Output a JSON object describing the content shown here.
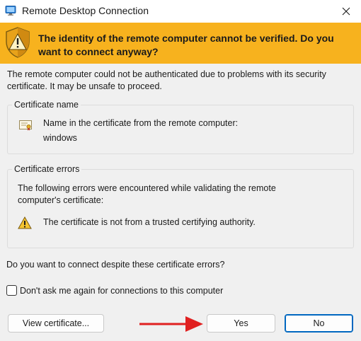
{
  "window": {
    "title": "Remote Desktop Connection",
    "close_glyph": "✕"
  },
  "banner": {
    "message": "The identity of the remote computer cannot be verified. Do you want to connect anyway?",
    "background_color": "#f7b21e"
  },
  "intro_text": "The remote computer could not be authenticated due to problems with its security certificate. It may be unsafe to proceed.",
  "certificate_name": {
    "group_title": "Certificate name",
    "label": "Name in the certificate from the remote computer:",
    "value": "windows"
  },
  "certificate_errors": {
    "group_title": "Certificate errors",
    "description": "The following errors were encountered while validating the remote computer's certificate:",
    "items": [
      "The certificate is not from a trusted certifying authority."
    ]
  },
  "question": "Do you want to connect despite these certificate errors?",
  "dont_ask": {
    "label": "Don't ask me again for connections to this computer",
    "checked": false
  },
  "buttons": {
    "view_certificate": "View certificate...",
    "yes": "Yes",
    "no": "No"
  },
  "annotation": {
    "arrow_color": "#e02020",
    "points_to": "yes-button"
  }
}
